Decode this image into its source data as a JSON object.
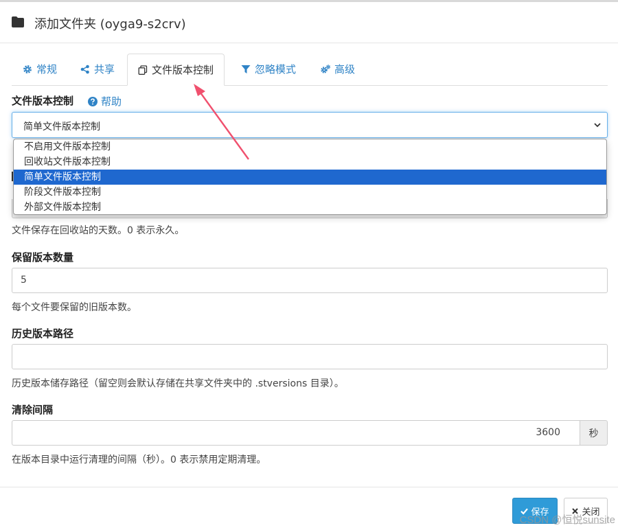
{
  "dialog": {
    "title": "添加文件夹 (oyga9-s2crv)",
    "icon": "folder-icon"
  },
  "tabs": [
    {
      "label": "常规",
      "icon": "cog-icon"
    },
    {
      "label": "共享",
      "icon": "share-icon"
    },
    {
      "label": "文件版本控制",
      "icon": "copy-icon",
      "active": true
    },
    {
      "label": "忽略模式",
      "icon": "filter-icon"
    },
    {
      "label": "高级",
      "icon": "cogs-icon"
    }
  ],
  "versioning": {
    "label": "文件版本控制",
    "help": "帮助",
    "selected": "简单文件版本控制",
    "options": [
      "不启用文件版本控制",
      "回收站文件版本控制",
      "简单文件版本控制",
      "阶段文件版本控制",
      "外部文件版本控制"
    ]
  },
  "trash_hint": "文件保存在回收站的天数。0 表示永久。",
  "keep_versions": {
    "label": "保留版本数量",
    "value": "5",
    "hint": "每个文件要保留的旧版本数。"
  },
  "versions_path": {
    "label": "历史版本路径",
    "value": "",
    "hint": "历史版本储存路径（留空则会默认存储在共享文件夹中的 .stversions 目录）。"
  },
  "cleanup": {
    "label": "清除间隔",
    "value": "3600",
    "unit": "秒",
    "hint": "在版本目录中运行清理的间隔（秒）。0 表示禁用定期清理。"
  },
  "footer": {
    "save": "保存",
    "close": "关闭"
  },
  "watermark": "CSDN @恒悦sunsite",
  "colors": {
    "link": "#2f83c6",
    "selected_option": "#1f68cf",
    "save_button": "#2f9bd8",
    "arrow": "#f0506e"
  }
}
